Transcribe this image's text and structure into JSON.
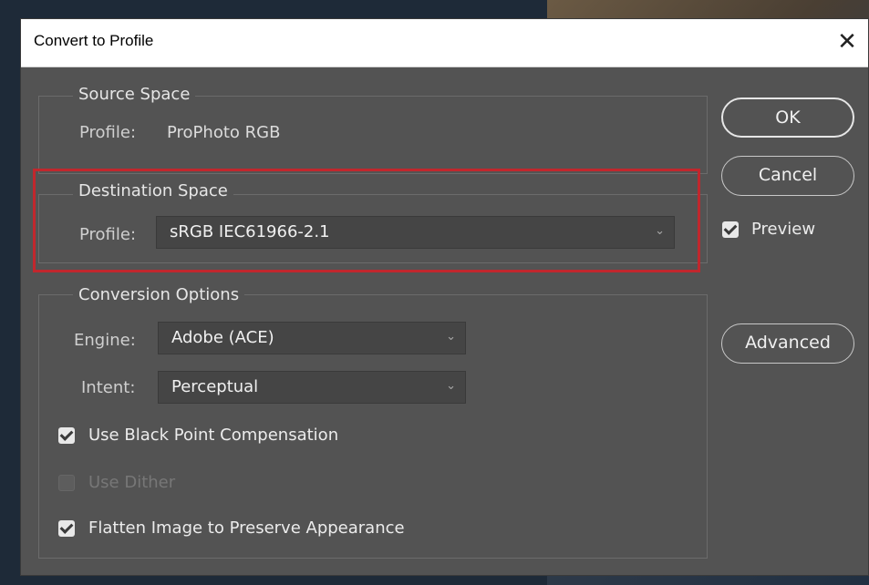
{
  "dialog": {
    "title": "Convert to Profile",
    "close_glyph": "✕"
  },
  "source_space": {
    "title": "Source Space",
    "profile_label": "Profile:",
    "profile_value": "ProPhoto RGB"
  },
  "destination_space": {
    "title": "Destination Space",
    "profile_label": "Profile:",
    "profile_value": "sRGB IEC61966-2.1",
    "highlight_color": "#c1272d"
  },
  "conversion_options": {
    "title": "Conversion Options",
    "engine_label": "Engine:",
    "engine_value": "Adobe (ACE)",
    "intent_label": "Intent:",
    "intent_value": "Perceptual",
    "black_point_label": "Use Black Point Compensation",
    "black_point_checked": true,
    "dither_label": "Use Dither",
    "dither_checked": false,
    "dither_enabled": false,
    "flatten_label": "Flatten Image to Preserve Appearance",
    "flatten_checked": true
  },
  "buttons": {
    "ok": "OK",
    "cancel": "Cancel",
    "advanced": "Advanced"
  },
  "preview": {
    "label": "Preview",
    "checked": true
  },
  "icons": {
    "dropdown_arrow": "chevron-down-icon",
    "close": "close-icon",
    "checkmark": "checkmark-icon"
  }
}
